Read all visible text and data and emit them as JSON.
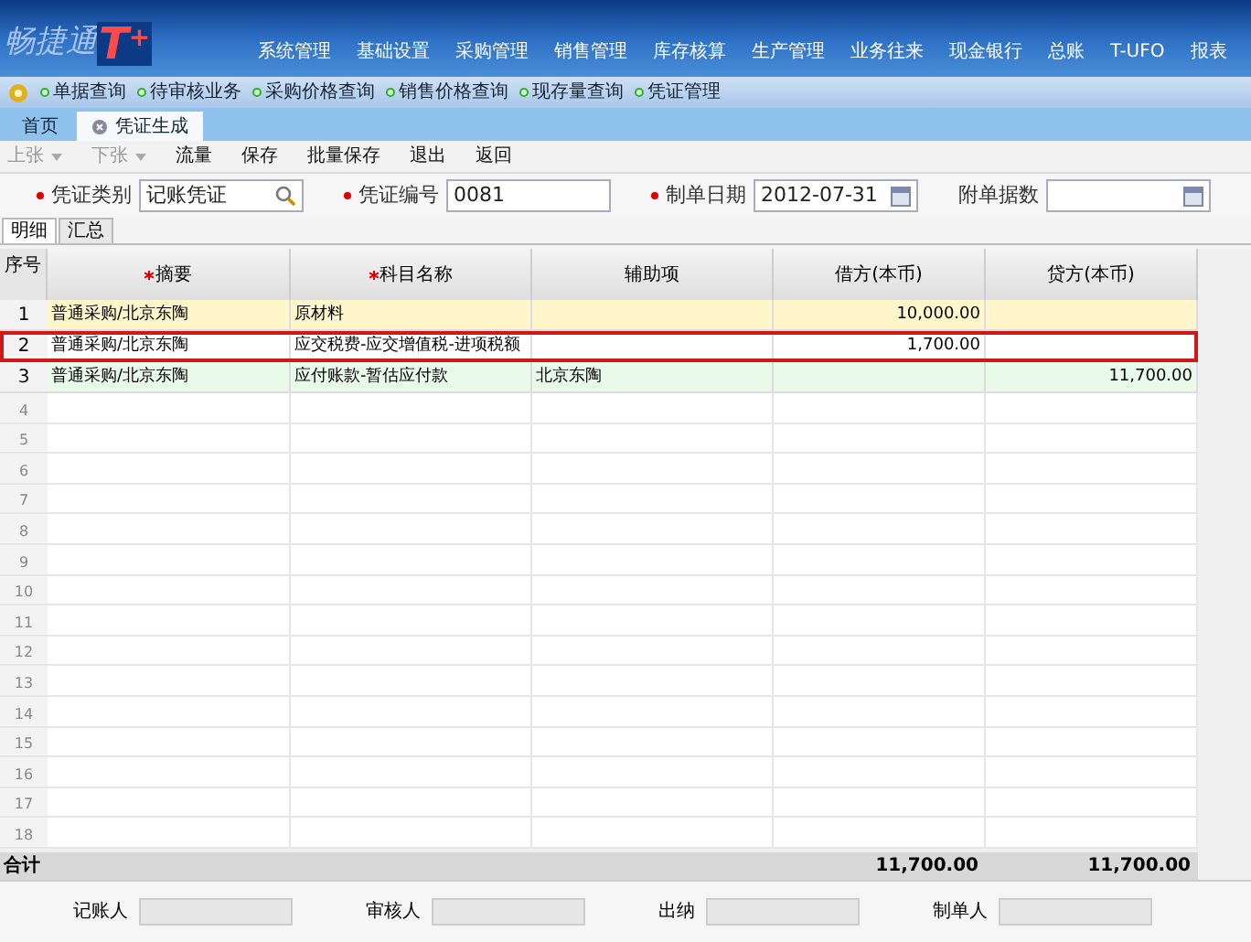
{
  "header": {
    "logo": "畅捷通",
    "logo_mark": "T",
    "logo_plus": "+",
    "menu": [
      "系统管理",
      "基础设置",
      "采购管理",
      "销售管理",
      "库存核算",
      "生产管理",
      "业务往来",
      "现金银行",
      "总账",
      "T-UFO",
      "报表"
    ]
  },
  "quick_links": [
    "单据查询",
    "待审核业务",
    "采购价格查询",
    "销售价格查询",
    "现存量查询",
    "凭证管理"
  ],
  "tabs": [
    {
      "label": "首页",
      "selected": false,
      "closable": false
    },
    {
      "label": "凭证生成",
      "selected": true,
      "closable": true
    }
  ],
  "toolbar": [
    {
      "label": "上张",
      "disabled": true,
      "dropdown": true
    },
    {
      "label": "下张",
      "disabled": true,
      "dropdown": true
    },
    {
      "label": "流量",
      "disabled": false,
      "dropdown": false
    },
    {
      "label": "保存",
      "disabled": false,
      "dropdown": false
    },
    {
      "label": "批量保存",
      "disabled": false,
      "dropdown": false
    },
    {
      "label": "退出",
      "disabled": false,
      "dropdown": false
    },
    {
      "label": "返回",
      "disabled": false,
      "dropdown": false
    }
  ],
  "form": [
    {
      "label": "凭证类别",
      "required": true,
      "value": "记账凭证",
      "kind": "search"
    },
    {
      "label": "凭证编号",
      "required": true,
      "value": "0081",
      "kind": "text"
    },
    {
      "label": "制单日期",
      "required": true,
      "value": "2012-07-31",
      "kind": "date"
    },
    {
      "label": "附单据数",
      "required": false,
      "kind": "date"
    }
  ],
  "sub_tabs": [
    {
      "label": "明细",
      "selected": true
    },
    {
      "label": "汇总",
      "selected": false
    }
  ],
  "table": {
    "row_header": "序号",
    "columns": [
      {
        "label": "摘要",
        "required": true
      },
      {
        "label": "科目名称",
        "required": true
      },
      {
        "label": "辅助项",
        "required": false
      },
      {
        "label": "借方(本币)",
        "required": false
      },
      {
        "label": "贷方(本币)",
        "required": false
      }
    ],
    "rows": [
      {
        "no": "1",
        "color": "#fff6cc",
        "selected": false,
        "cells": [
          "普通采购/北京东陶",
          "原材料",
          "",
          "10,000.00",
          ""
        ]
      },
      {
        "no": "2",
        "color": "#ffffff",
        "selected": true,
        "cells": [
          "普通采购/北京东陶",
          "应交税费-应交增值税-进项税额",
          "",
          "1,700.00",
          ""
        ]
      },
      {
        "no": "3",
        "color": "#eafaea",
        "selected": false,
        "cells": [
          "普通采购/北京东陶",
          "应付账款-暂估应付款",
          "北京东陶",
          "",
          "11,700.00"
        ]
      }
    ],
    "empty_rows": [
      "4",
      "5",
      "6",
      "7",
      "8",
      "9",
      "10",
      "11",
      "12",
      "13",
      "14",
      "15",
      "16",
      "17",
      "18"
    ],
    "total": {
      "label": "合计",
      "debit": "11,700.00",
      "credit": "11,700.00"
    }
  },
  "footer": [
    {
      "label": "记账人"
    },
    {
      "label": "审核人"
    },
    {
      "label": "出纳"
    },
    {
      "label": "制单人"
    }
  ]
}
